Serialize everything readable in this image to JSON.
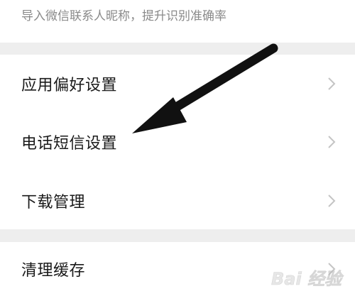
{
  "top_note": "导入微信联系人昵称，提升识别准确率",
  "settings": {
    "items": [
      {
        "label": "应用偏好设置"
      },
      {
        "label": "电话短信设置"
      },
      {
        "label": "下载管理"
      },
      {
        "label": "清理缓存"
      }
    ]
  },
  "icons": {
    "chevron": "chevron-right-icon",
    "arrow": "annotation-arrow-icon",
    "watermark": "baidu-watermark-logo"
  },
  "watermark": {
    "text": "Bai 经验"
  },
  "colors": {
    "divider": "#eeeeee",
    "text": "#1a1a1a",
    "secondary_text": "#8a8a8a",
    "chevron": "#c4c4c4",
    "arrow": "#111111"
  }
}
